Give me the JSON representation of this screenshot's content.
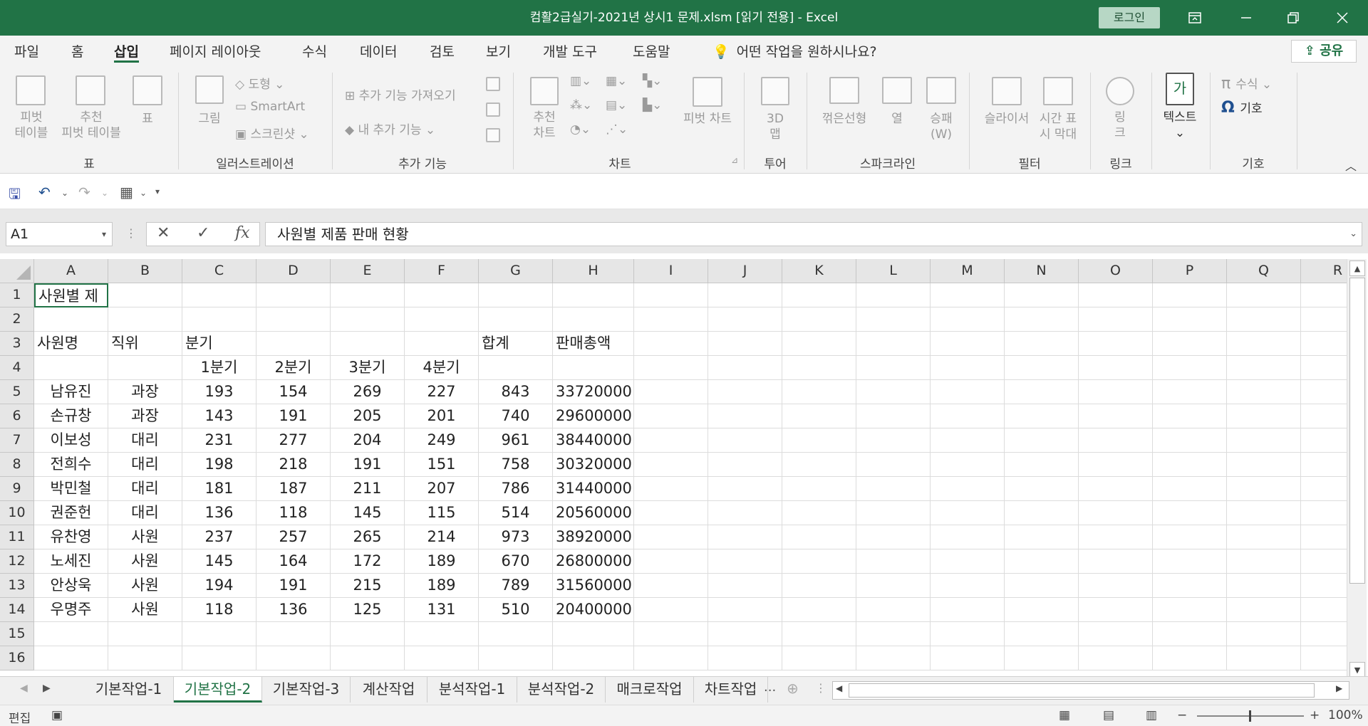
{
  "titlebar": {
    "title": "컴활2급실기-2021년 상시1 문제.xlsm  [읽기 전용]  -  Excel",
    "login": "로그인",
    "icons": [
      "ribbon-display-icon",
      "minimize-icon",
      "restore-icon",
      "close-icon"
    ]
  },
  "menu": {
    "tabs": [
      "파일",
      "홈",
      "삽입",
      "페이지 레이아웃",
      "수식",
      "데이터",
      "검토",
      "보기",
      "개발 도구",
      "도움말"
    ],
    "active": "삽입",
    "tell_me": "어떤 작업을 원하시나요?",
    "share": "공유"
  },
  "ribbon": {
    "groups": {
      "table": "표",
      "illustrations": "일러스트레이션",
      "addins": "추가 기능",
      "charts": "차트",
      "tours": "투어",
      "sparklines": "스파크라인",
      "filters": "필터",
      "links": "링크",
      "symbols": "기호"
    },
    "items": {
      "pivot_table": "피벗\n테이블",
      "recommended_pivot": "추천\n피벗 테이블",
      "table": "표",
      "pictures": "그림",
      "shapes": "도형",
      "smartart": "SmartArt",
      "screenshot": "스크린샷",
      "get_addins": "추가 기능 가져오기",
      "my_addins": "내 추가 기능",
      "recommended_charts": "추천\n차트",
      "pivot_chart": "피벗 차트",
      "map_3d": "3D\n맵",
      "line": "꺾은선형",
      "column": "열",
      "win_loss": "승패\n(W)",
      "slicer": "슬라이서",
      "timeline": "시간 표\n시 막대",
      "link": "링\n크",
      "text": "텍스트",
      "equation": "수식",
      "symbol": "기호"
    }
  },
  "formula_bar": {
    "name_box": "A1",
    "cancel": "✕",
    "enter": "✓",
    "fx": "fx",
    "content": "사원별 제품 판매 현황"
  },
  "sheet": {
    "columns": [
      "A",
      "B",
      "C",
      "D",
      "E",
      "F",
      "G",
      "H",
      "I",
      "J",
      "K",
      "L",
      "M",
      "N",
      "O",
      "P",
      "Q",
      "R"
    ],
    "rows": [
      "1",
      "2",
      "3",
      "4",
      "5",
      "6",
      "7",
      "8",
      "9",
      "10",
      "11",
      "12",
      "13",
      "14",
      "15",
      "16"
    ],
    "a1_text": "사원별 제",
    "headers_row3": [
      "사원명",
      "직위",
      "분기",
      "합계",
      "판매총액"
    ],
    "headers_row4": [
      "1분기",
      "2분기",
      "3분기",
      "4분기"
    ],
    "data": [
      [
        "남유진",
        "과장",
        "193",
        "154",
        "269",
        "227",
        "843",
        "33720000"
      ],
      [
        "손규창",
        "과장",
        "143",
        "191",
        "205",
        "201",
        "740",
        "29600000"
      ],
      [
        "이보성",
        "대리",
        "231",
        "277",
        "204",
        "249",
        "961",
        "38440000"
      ],
      [
        "전희수",
        "대리",
        "198",
        "218",
        "191",
        "151",
        "758",
        "30320000"
      ],
      [
        "박민철",
        "대리",
        "181",
        "187",
        "211",
        "207",
        "786",
        "31440000"
      ],
      [
        "권준헌",
        "대리",
        "136",
        "118",
        "145",
        "115",
        "514",
        "20560000"
      ],
      [
        "유찬영",
        "사원",
        "237",
        "257",
        "265",
        "214",
        "973",
        "38920000"
      ],
      [
        "노세진",
        "사원",
        "145",
        "164",
        "172",
        "189",
        "670",
        "26800000"
      ],
      [
        "안상욱",
        "사원",
        "194",
        "191",
        "215",
        "189",
        "789",
        "31560000"
      ],
      [
        "우명주",
        "사원",
        "118",
        "136",
        "125",
        "131",
        "510",
        "20400000"
      ]
    ]
  },
  "sheet_tabs": {
    "tabs": [
      "기본작업-1",
      "기본작업-2",
      "기본작업-3",
      "계산작업",
      "분석작업-1",
      "분석작업-2",
      "매크로작업",
      "차트작업"
    ],
    "active": "기본작업-2",
    "more": "..."
  },
  "status": {
    "mode": "편집",
    "zoom": "100%"
  },
  "colors": {
    "accent": "#217346",
    "grid": "#dcdcdc"
  }
}
